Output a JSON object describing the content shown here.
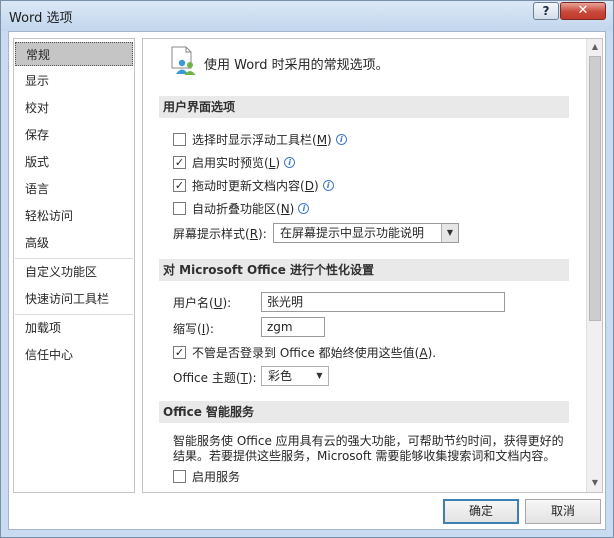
{
  "window": {
    "title": "Word 选项",
    "help_label": "?",
    "close_label": "✕"
  },
  "sidebar": {
    "items": [
      {
        "label": "常规"
      },
      {
        "label": "显示"
      },
      {
        "label": "校对"
      },
      {
        "label": "保存"
      },
      {
        "label": "版式"
      },
      {
        "label": "语言"
      },
      {
        "label": "轻松访问"
      },
      {
        "label": "高级"
      },
      {
        "label": "自定义功能区"
      },
      {
        "label": "快速访问工具栏"
      },
      {
        "label": "加载项"
      },
      {
        "label": "信任中心"
      }
    ],
    "selected": "常规"
  },
  "main": {
    "intro_icon": "people-settings-icon",
    "intro": "使用 Word 时采用的常规选项。",
    "ui_section": {
      "title": "用户界面选项",
      "options": [
        {
          "label": "选择时显示浮动工具栏(",
          "key": "M",
          "suffix": ")",
          "checked": false
        },
        {
          "label": "启用实时预览(",
          "key": "L",
          "suffix": ")",
          "checked": true
        },
        {
          "label": "拖动时更新文档内容(",
          "key": "D",
          "suffix": ")",
          "checked": true
        },
        {
          "label": "自动折叠功能区(",
          "key": "N",
          "suffix": ")",
          "checked": false
        }
      ],
      "screentip_label_pre": "屏幕提示样式(",
      "screentip_key": "R",
      "screentip_label_post": "):",
      "screentip_value": "在屏幕提示中显示功能说明"
    },
    "personalize_section": {
      "title": "对 Microsoft Office 进行个性化设置",
      "username_pre": "用户名(",
      "username_key": "U",
      "username_post": "):",
      "username_value": "张光明",
      "initials_pre": "缩写(",
      "initials_key": "I",
      "initials_post": "):",
      "initials_value": "zgm",
      "always_use_pre": "不管是否登录到 Office 都始终使用这些值(",
      "always_use_key": "A",
      "always_use_post": ").",
      "always_use_checked": true,
      "theme_pre": "Office 主题(",
      "theme_key": "T",
      "theme_post": "):",
      "theme_value": "彩色"
    },
    "intelligent_section": {
      "title": "Office 智能服务",
      "description": "智能服务使 Office 应用具有云的强大功能，可帮助节约时间，获得更好的结果。若要提供这些服务，Microsoft 需要能够收集搜索词和文档内容。",
      "enable_label": "启用服务",
      "enable_checked": false
    }
  },
  "buttons": {
    "ok": "确定",
    "cancel": "取消"
  },
  "colors": {
    "title_bar": "#c2d6ee",
    "close_button": "#c7473a",
    "selected_nav": "#c5c5c5",
    "section_header": "#e9e9e9",
    "default_button_border": "#3c7fb1",
    "info_icon": "#3f78c9"
  }
}
